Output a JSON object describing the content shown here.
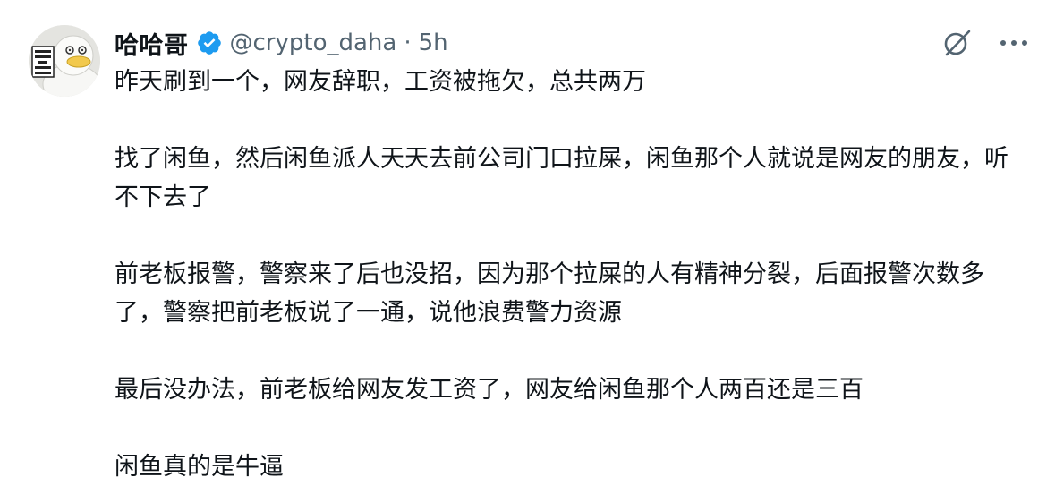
{
  "author": {
    "display_name": "哈哈哥",
    "handle": "@crypto_daha",
    "separator": "·",
    "time_ago": "5h",
    "verified": true,
    "verified_color": "#1d9bf0"
  },
  "icons": {
    "avatar": "duck-avatar-icon",
    "verified": "verified-badge-icon",
    "grok": "grok-icon",
    "more": "more-options-icon"
  },
  "tweet": {
    "paragraphs": [
      "昨天刷到一个，网友辞职，工资被拖欠，总共两万",
      "找了闲鱼，然后闲鱼派人天天去前公司门口拉屎，闲鱼那个人就说是网友的朋友，听不下去了",
      "前老板报警，警察来了后也没招，因为那个拉屎的人有精神分裂，后面报警次数多了，警察把前老板说了一通，说他浪费警力资源",
      "最后没办法，前老板给网友发工资了，网友给闲鱼那个人两百还是三百",
      "闲鱼真的是牛逼"
    ]
  },
  "colors": {
    "text": "#0f1419",
    "secondary_text": "#536471"
  }
}
